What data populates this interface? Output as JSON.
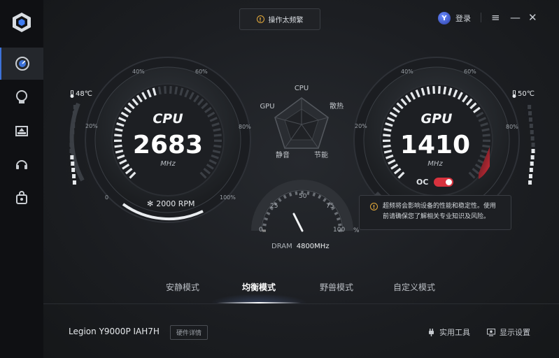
{
  "header": {
    "warning_button": "操作太频繁",
    "login_label": "登录",
    "avatar_letter": "Y",
    "menu_icon": "menu-icon",
    "minimize_icon": "minimize-icon",
    "close_icon": "close-icon"
  },
  "sidebar": {
    "items": [
      {
        "icon": "dashboard-gauge-icon",
        "active": true
      },
      {
        "icon": "lightbulb-icon",
        "active": false
      },
      {
        "icon": "upload-tray-icon",
        "active": false
      },
      {
        "icon": "headset-icon",
        "active": false
      },
      {
        "icon": "bag-icon",
        "active": false
      }
    ]
  },
  "cpu_gauge": {
    "title": "CPU",
    "value": "2683",
    "unit": "MHz",
    "temperature": "48℃",
    "ticks": [
      "0",
      "20%",
      "40%",
      "60%",
      "80%",
      "100%"
    ],
    "fan_label": "2000 RPM",
    "fill_fraction": 0.45
  },
  "gpu_gauge": {
    "title": "GPU",
    "value": "1410",
    "unit": "MHz",
    "temperature": "50℃",
    "ticks": [
      "20%",
      "40%",
      "60%",
      "80%"
    ],
    "oc_label": "OC",
    "oc_enabled": true,
    "fill_fraction": 0.7
  },
  "radar": {
    "labels": [
      "CPU",
      "散热",
      "节能",
      "静音",
      "GPU"
    ]
  },
  "dram_gauge": {
    "ticks": [
      "0",
      "25",
      "50",
      "75",
      "100"
    ],
    "percent_symbol": "%",
    "label": "DRAM",
    "value": "4800MHz"
  },
  "tooltip": {
    "text_line1": "超频将会影响设备的性能和稳定性。使用",
    "text_line2": "前请确保您了解相关专业知识及风险。",
    "icon_glyph": "!"
  },
  "modes": {
    "items": [
      "安静模式",
      "均衡模式",
      "野兽模式",
      "自定义模式"
    ],
    "active_index": 1
  },
  "footer": {
    "device_name": "Legion Y9000P IAH7H",
    "hardware_details": "硬件详情",
    "tools_label": "实用工具",
    "display_label": "显示设置"
  },
  "colors": {
    "accent_blue": "#3d72d9",
    "warning": "#e3a93b",
    "danger": "#d8323e"
  }
}
